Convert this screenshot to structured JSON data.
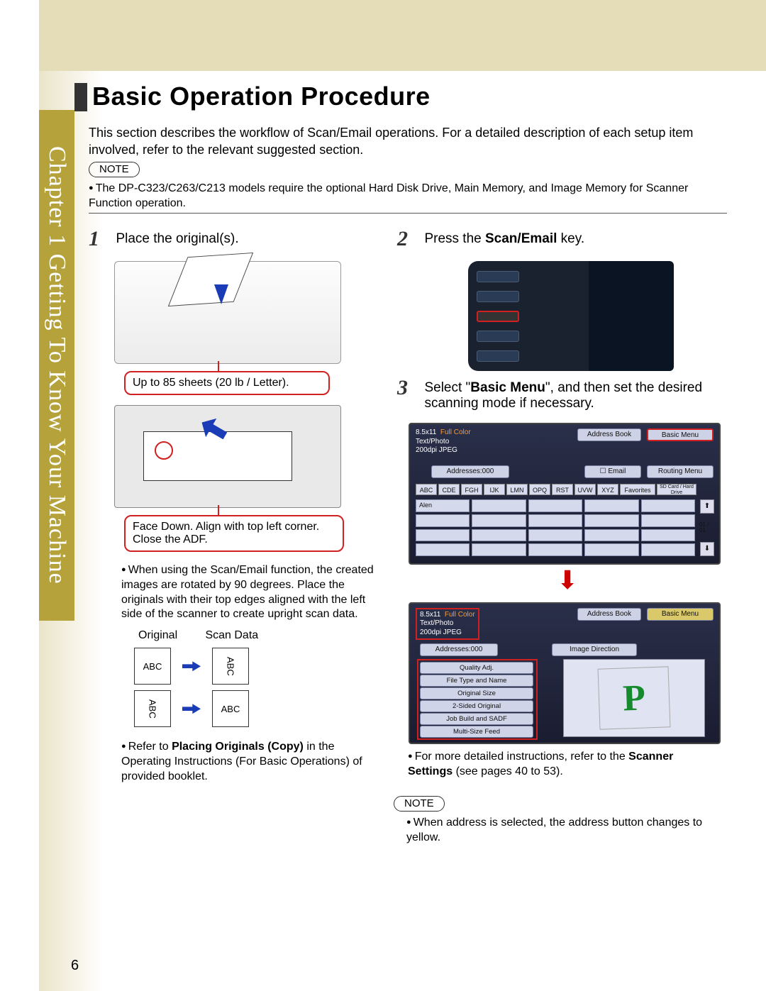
{
  "chapter_tab": "Chapter 1    Getting To Know Your Machine",
  "title": "Basic Operation Procedure",
  "intro": "This section describes the workflow of Scan/Email operations. For a detailed description of each setup item involved, refer to the relevant suggested section.",
  "note_label": "NOTE",
  "note1": "The DP-C323/C263/C213 models require the optional Hard Disk Drive, Main Memory, and Image Memory for Scanner Function operation.",
  "step1": {
    "num": "1",
    "text": "Place the original(s).",
    "callout1": "Up to 85 sheets (20 lb / Letter).",
    "callout2": "Face Down. Align with top left corner. Close the ADF.",
    "bullet1": "When using the Scan/Email function, the created images are rotated by 90 degrees. Place the originals with their top edges aligned with the left side of the scanner to create upright scan data.",
    "mini_original": "Original",
    "mini_scan": "Scan Data",
    "abc": "ABC",
    "bullet2_pre": "Refer to ",
    "bullet2_bold": "Placing Originals (Copy)",
    "bullet2_post": " in the Operating Instructions (For Basic Operations) of provided booklet."
  },
  "step2": {
    "num": "2",
    "text_pre": "Press the ",
    "text_bold": "Scan/Email",
    "text_post": " key."
  },
  "step3": {
    "num": "3",
    "text_pre": "Select \"",
    "text_bold": "Basic Menu",
    "text_post": "\", and then set the desired scanning mode if necessary.",
    "screen1": {
      "size": "8.5x11",
      "mode": "Full Color",
      "type": "Text/Photo",
      "res": "200dpi JPEG",
      "addr_counter": "Addresses:000",
      "address_book": "Address Book",
      "basic_menu": "Basic Menu",
      "email": "Email",
      "routing": "Routing Menu",
      "tabs": [
        "ABC",
        "CDE",
        "FGH",
        "IJK",
        "LMN",
        "OPQ",
        "RST",
        "UVW",
        "XYZ"
      ],
      "favorites": "Favorites",
      "sdcard": "SD Card / Hard Drive",
      "first_entry": "Alen",
      "scroll": [
        "⬆",
        "01 / 01",
        "⬇"
      ]
    },
    "screen2": {
      "size": "8.5x11",
      "mode": "Full Color",
      "type": "Text/Photo",
      "res": "200dpi JPEG",
      "addr_counter": "Addresses:000",
      "address_book": "Address Book",
      "basic_menu": "Basic Menu",
      "image_dir": "Image Direction",
      "items": [
        "Quality Adj.",
        "File Type and Name",
        "Original Size",
        "2-Sided Original",
        "Job Build and SADF",
        "Multi-Size Feed"
      ],
      "preview_letter": "P"
    },
    "bullet_pre": "For more detailed instructions, refer to the ",
    "bullet_bold": "Scanner Settings",
    "bullet_post": " (see pages 40 to 53)."
  },
  "note2": "When address is selected, the address button changes to yellow.",
  "page_number": "6"
}
